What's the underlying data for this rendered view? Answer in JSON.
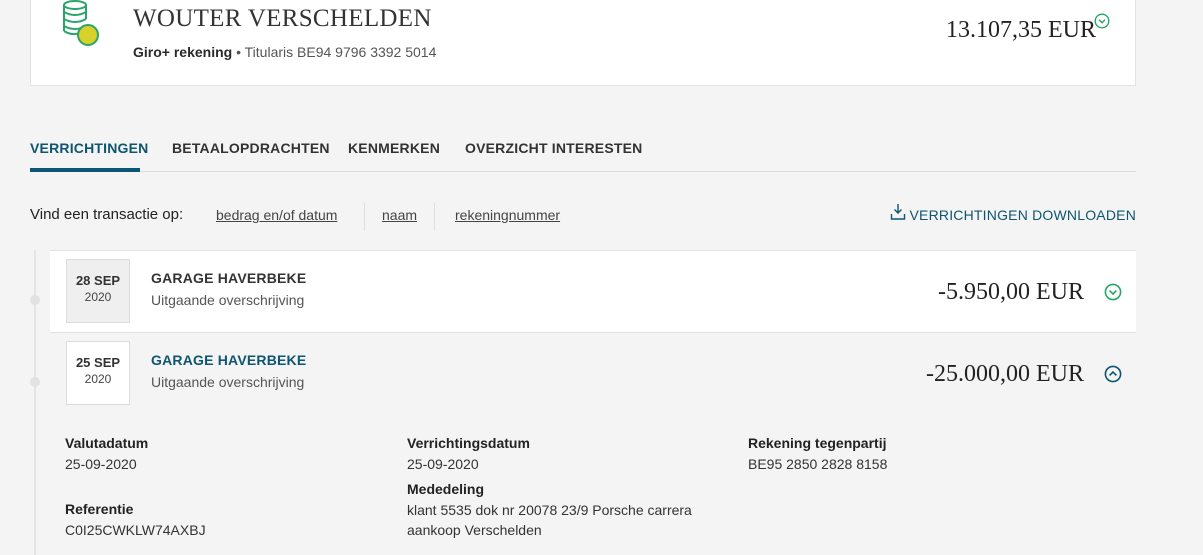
{
  "account": {
    "holder_name": "WOUTER VERSCHELDEN",
    "type": "Giro+ rekening",
    "separator": " • ",
    "holder_label": "Titularis",
    "iban": "BE94 9796 3392 5014",
    "balance": "13.107,35 EUR",
    "icon": "coins-icon"
  },
  "tabs": [
    {
      "label": "VERRICHTINGEN",
      "active": true
    },
    {
      "label": "BETAALOPDRACHTEN",
      "active": false
    },
    {
      "label": "KENMERKEN",
      "active": false
    },
    {
      "label": "OVERZICHT INTERESTEN",
      "active": false
    }
  ],
  "filter": {
    "label": "Vind een transactie op:",
    "links": [
      "bedrag en/of datum",
      "naam",
      "rekeningnummer"
    ],
    "download_label": "VERRICHTINGEN DOWNLOADEN"
  },
  "transactions": [
    {
      "day": "28 SEP",
      "year": "2020",
      "name": "GARAGE HAVERBEKE",
      "type": "Uitgaande overschrijving",
      "amount": "-5.950,00 EUR",
      "expanded": false
    },
    {
      "day": "25 SEP",
      "year": "2020",
      "name": "GARAGE HAVERBEKE",
      "type": "Uitgaande overschrijving",
      "amount": "-25.000,00 EUR",
      "expanded": true,
      "details": {
        "valuta_label": "Valutadatum",
        "valuta_value": "25-09-2020",
        "verrichting_label": "Verrichtingsdatum",
        "verrichting_value": "25-09-2020",
        "tegenpartij_label": "Rekening tegenpartij",
        "tegenpartij_value": "BE95 2850 2828 8158",
        "referentie_label": "Referentie",
        "referentie_value": "C0I25CWKLW74AXBJ",
        "mededeling_label": "Mededeling",
        "mededeling_line1": "klant 5535 dok nr 20078 23/9 Porsche carrera",
        "mededeling_line2": "aankoop Verschelden"
      }
    }
  ],
  "colors": {
    "accent": "#0d5570",
    "positive_green": "#2aa56a",
    "coin_yellow": "#d7d12a"
  }
}
